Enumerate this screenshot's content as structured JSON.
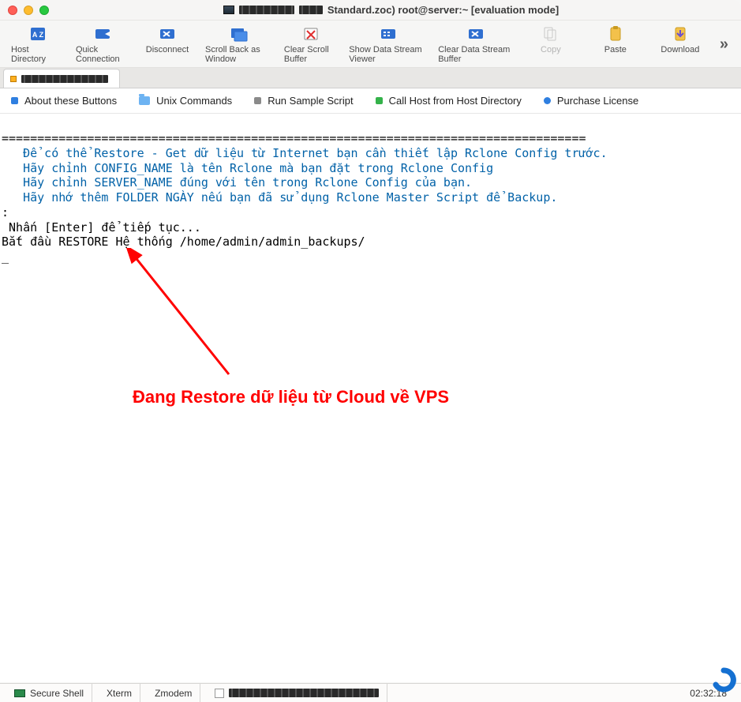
{
  "title": "Standard.zoc) root@server:~ [evaluation mode]",
  "toolbar": [
    {
      "id": "host-directory",
      "label": "Host Directory"
    },
    {
      "id": "quick-connection",
      "label": "Quick Connection"
    },
    {
      "id": "disconnect",
      "label": "Disconnect"
    },
    {
      "id": "scroll-back",
      "label": "Scroll Back as Window"
    },
    {
      "id": "clear-scroll",
      "label": "Clear Scroll Buffer"
    },
    {
      "id": "show-data-stream",
      "label": "Show Data Stream Viewer"
    },
    {
      "id": "clear-data-stream",
      "label": "Clear Data Stream Buffer"
    },
    {
      "id": "copy",
      "label": "Copy",
      "disabled": true
    },
    {
      "id": "paste",
      "label": "Paste"
    },
    {
      "id": "download",
      "label": "Download"
    }
  ],
  "tab_label": "",
  "quicklinks": [
    {
      "id": "about-buttons",
      "label": "About these Buttons",
      "color": "#2f7fe0"
    },
    {
      "id": "unix-commands",
      "label": "Unix Commands",
      "folder": true
    },
    {
      "id": "run-sample",
      "label": "Run Sample Script",
      "color": "#8a8a8a"
    },
    {
      "id": "call-host",
      "label": "Call Host from Host Directory",
      "color": "#34b24a"
    },
    {
      "id": "purchase",
      "label": "Purchase License",
      "color": "#2f7fe0"
    }
  ],
  "terminal": {
    "rule": "==================================================================================",
    "lines_teal": [
      "   Để có thể Restore - Get dữ liệu từ Internet bạn cần thiết lập Rclone Config trước.",
      "   Hãy chỉnh CONFIG_NAME là tên Rclone mà bạn đặt trong Rclone Config",
      "   Hãy chỉnh SERVER_NAME đúng với tên trong Rclone Config của bạn.",
      "   Hãy nhớ thêm FOLDER NGÀY nếu bạn đã sử dụng Rclone Master Script để Backup."
    ],
    "lines_black": [
      ":",
      " Nhấn [Enter] để tiếp tục...",
      "Bắt đầu RESTORE Hệ thống /home/admin/admin_backups/",
      "_"
    ]
  },
  "annotation": "Đang Restore dữ liệu từ Cloud về VPS",
  "status": {
    "shell": "Secure Shell",
    "term": "Xterm",
    "proto": "Zmodem",
    "time": "02:32:18"
  }
}
